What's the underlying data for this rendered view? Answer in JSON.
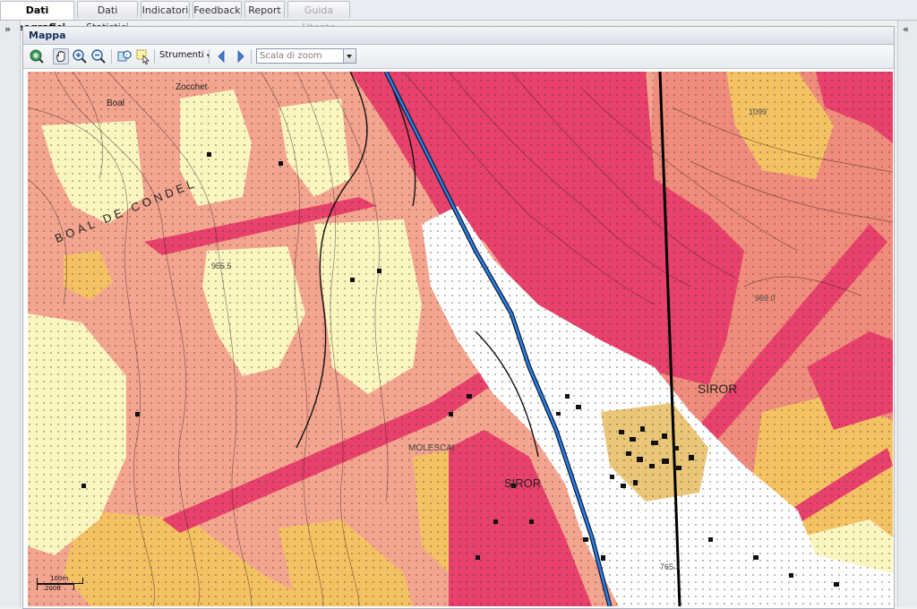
{
  "tabs": [
    {
      "label": "Dati Geografici",
      "state": "active"
    },
    {
      "label": "Dati Statistici",
      "state": "normal"
    },
    {
      "label": "Indicatori",
      "state": "normal"
    },
    {
      "label": "Feedback",
      "state": "normal"
    },
    {
      "label": "Report",
      "state": "normal"
    },
    {
      "label": "Guida Utente",
      "state": "disabled"
    }
  ],
  "panel": {
    "title": "Mappa"
  },
  "toolbar": {
    "strumenti_label": "Strumenti",
    "zoom_placeholder": "Scala di zoom",
    "icons": [
      "zoom-extent-icon",
      "pan-hand-icon",
      "zoom-in-icon",
      "zoom-out-icon",
      "identify-icon",
      "select-features-icon",
      "back-arrow-icon",
      "forward-arrow-icon"
    ]
  },
  "side": {
    "left_arrow": "»",
    "right_arrow": "«"
  },
  "map": {
    "labels": {
      "siror_east": "SIROR",
      "siror_center": "SIROR",
      "molescai": "MOLESCAI",
      "boal_de_condel": "BOAL DE CONDEL",
      "boal": "Boal",
      "zocchet": "Zocchet",
      "spot_1": "955.5",
      "spot_2": "969.0",
      "spot_3": "765.3",
      "spot_4": "1099"
    },
    "scale": {
      "top": "100m",
      "bottom": "200ft"
    },
    "colors": {
      "salmon": "#f4a58f",
      "crimson": "#e8416b",
      "cream": "#fbf6c0",
      "gold": "#f4c263",
      "white": "#ffffff",
      "river": "#2d7fe0"
    }
  }
}
